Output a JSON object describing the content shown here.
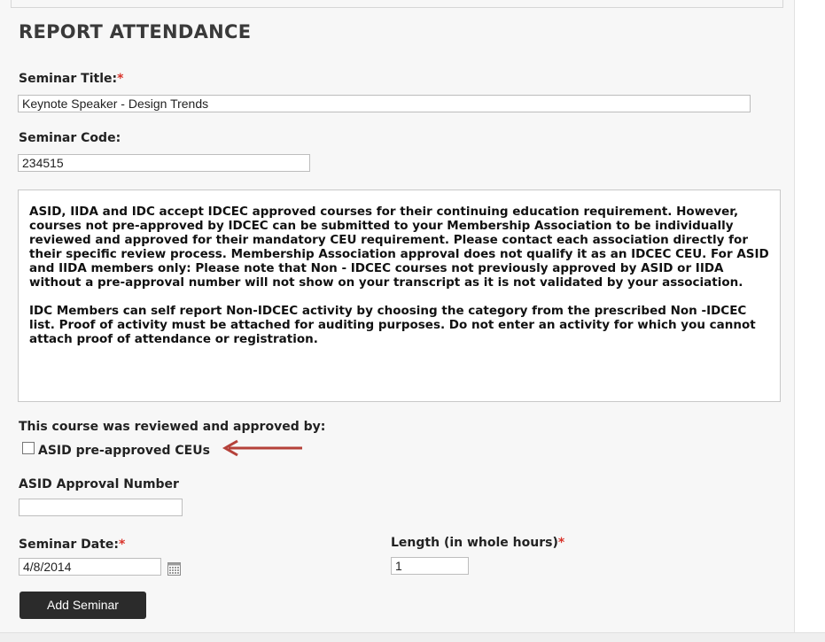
{
  "page": {
    "title": "REPORT ATTENDANCE"
  },
  "form": {
    "seminar_title": {
      "label": "Seminar Title:",
      "required_mark": "*",
      "value": "Keynote Speaker - Design Trends"
    },
    "seminar_code": {
      "label": "Seminar Code:",
      "value": "234515"
    },
    "notice": {
      "paragraph1": "ASID, IIDA and IDC accept IDCEC approved courses for their continuing education requirement. However, courses not pre-approved by IDCEC can be submitted to your Membership Association to be individually reviewed and approved for their mandatory CEU requirement. Please contact each association directly for their specific review process. Membership Association approval does not qualify it as an IDCEC CEU. For ASID and IIDA members only: Please note that Non - IDCEC courses not previously approved by ASID or IIDA without a pre-approval number will not show on your transcript as it is not validated by your association.",
      "paragraph2": "IDC Members can self report Non-IDCEC activity by choosing the category from the prescribed Non -IDCEC list. Proof of activity must be attached for auditing purposes. Do not enter an activity for which you cannot attach proof of attendance or registration."
    },
    "approval": {
      "heading": "This course was reviewed and approved by:",
      "checkbox_label": "ASID pre-approved CEUs",
      "checked": false
    },
    "asid_approval_number": {
      "label": "ASID Approval Number",
      "value": ""
    },
    "seminar_date": {
      "label": "Seminar Date:",
      "required_mark": "*",
      "value": "4/8/2014"
    },
    "length": {
      "label": "Length (in whole hours)",
      "required_mark": "*",
      "value": "1"
    },
    "submit_label": "Add Seminar"
  },
  "colors": {
    "required": "#d9342b",
    "arrow": "#b5413a",
    "button": "#2b2b2b"
  },
  "icons": {
    "calendar": "calendar-icon",
    "annotation_arrow": "arrow-left-icon"
  }
}
